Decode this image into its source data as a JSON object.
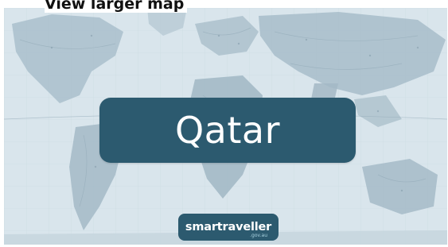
{
  "map_link": {
    "label": "View larger map"
  },
  "banner": {
    "country": "Qatar"
  },
  "brand": {
    "name": "smartraveller",
    "domain": ".gov.au"
  },
  "colors": {
    "banner_bg": "#2c5a6f",
    "map_ocean": "#d6e3ea",
    "map_land": "#a9bfcc",
    "text_light": "#ffffff"
  },
  "icons": {
    "background": "world-map-background"
  }
}
